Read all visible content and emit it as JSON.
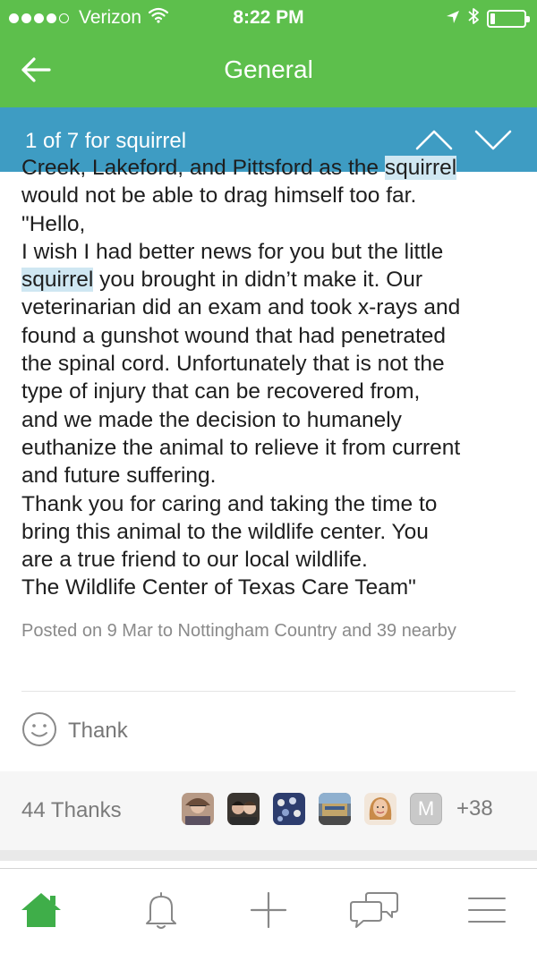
{
  "status_bar": {
    "carrier": "Verizon",
    "time": "8:22 PM",
    "signal_bars": 4,
    "signal_total": 5,
    "battery_level": 0.15
  },
  "navbar": {
    "title": "General",
    "back_icon": "arrow-left-icon"
  },
  "search": {
    "count_text": "1 of 7 for squirrel",
    "prev_icon": "chevron-up-icon",
    "next_icon": "chevron-down-icon"
  },
  "post": {
    "lines": [
      {
        "before": "Creek, Lakeford, and Pittsford as the ",
        "hl": "squirrel",
        "after": ""
      },
      {
        "before": "would not be able to drag himself too far.",
        "hl": "",
        "after": ""
      },
      {
        "before": "\"Hello,",
        "hl": "",
        "after": ""
      },
      {
        "before": "I wish I had better news for you but the little",
        "hl": "",
        "after": ""
      },
      {
        "before": "",
        "hl": "squirrel",
        "after": " you brought in didn’t make it. Our"
      },
      {
        "before": "veterinarian did an exam and took x-rays and",
        "hl": "",
        "after": ""
      },
      {
        "before": "found a gunshot wound that had penetrated",
        "hl": "",
        "after": ""
      },
      {
        "before": "the spinal cord. Unfortunately that is not the",
        "hl": "",
        "after": ""
      },
      {
        "before": "type of injury that can be recovered from,",
        "hl": "",
        "after": ""
      },
      {
        "before": "and we made the decision to humanely",
        "hl": "",
        "after": ""
      },
      {
        "before": "euthanize the animal to relieve it from current",
        "hl": "",
        "after": ""
      },
      {
        "before": "and future suffering.",
        "hl": "",
        "after": ""
      },
      {
        "before": "Thank you for caring and taking the time to",
        "hl": "",
        "after": ""
      },
      {
        "before": "bring this animal to the wildlife center. You",
        "hl": "",
        "after": ""
      },
      {
        "before": "are a true friend to our local wildlife.",
        "hl": "",
        "after": ""
      },
      {
        "before": "The Wildlife Center of Texas Care Team\"",
        "hl": "",
        "after": ""
      }
    ],
    "posted_meta": "Posted on 9 Mar to Nottingham Country and 39 nearby"
  },
  "thank_button": {
    "label": "Thank",
    "icon": "smiley-icon"
  },
  "thanks": {
    "count_label": "44 Thanks",
    "more_label": "+38",
    "placeholder_initial": "M"
  },
  "tabbar": {
    "items": [
      {
        "icon": "home-icon",
        "active": true
      },
      {
        "icon": "bell-icon",
        "active": false
      },
      {
        "icon": "plus-icon",
        "active": false
      },
      {
        "icon": "chat-icon",
        "active": false
      },
      {
        "icon": "menu-icon",
        "active": false
      }
    ]
  },
  "colors": {
    "header_green": "#5dbf4c",
    "search_blue": "#3e9cc3",
    "highlight": "#cfe7f2"
  }
}
